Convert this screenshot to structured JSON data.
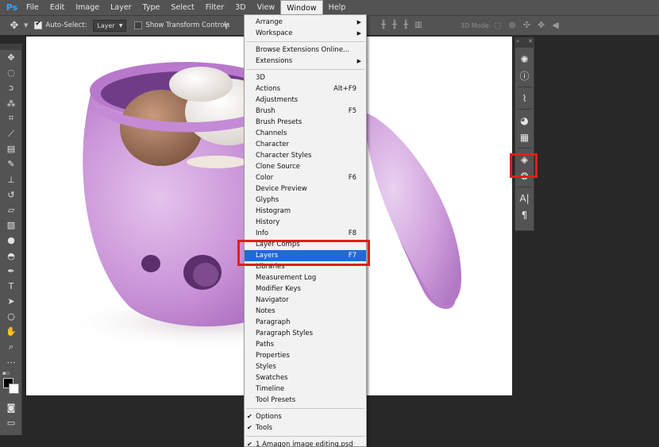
{
  "app": {
    "logo": "Ps"
  },
  "menubar": {
    "items": [
      "File",
      "Edit",
      "Image",
      "Layer",
      "Type",
      "Select",
      "Filter",
      "3D",
      "View",
      "Window",
      "Help"
    ],
    "active": "Window"
  },
  "options": {
    "auto_select_label": "Auto-Select:",
    "auto_select_value": "Layer",
    "transform_label": "Show Transform Controls",
    "mode3d_label": "3D Mode:"
  },
  "window_menu": {
    "group1": [
      {
        "label": "Arrange",
        "submenu": true
      },
      {
        "label": "Workspace",
        "submenu": true
      }
    ],
    "group2": [
      {
        "label": "Browse Extensions Online...",
        "submenu": false
      },
      {
        "label": "Extensions",
        "submenu": true
      }
    ],
    "group3": [
      {
        "label": "3D",
        "shortcut": ""
      },
      {
        "label": "Actions",
        "shortcut": "Alt+F9"
      },
      {
        "label": "Adjustments",
        "shortcut": ""
      },
      {
        "label": "Brush",
        "shortcut": "F5"
      },
      {
        "label": "Brush Presets",
        "shortcut": ""
      },
      {
        "label": "Channels",
        "shortcut": ""
      },
      {
        "label": "Character",
        "shortcut": ""
      },
      {
        "label": "Character Styles",
        "shortcut": ""
      },
      {
        "label": "Clone Source",
        "shortcut": ""
      },
      {
        "label": "Color",
        "shortcut": "F6"
      },
      {
        "label": "Device Preview",
        "shortcut": ""
      },
      {
        "label": "Glyphs",
        "shortcut": ""
      },
      {
        "label": "Histogram",
        "shortcut": ""
      },
      {
        "label": "History",
        "shortcut": ""
      },
      {
        "label": "Info",
        "shortcut": "F8"
      },
      {
        "label": "Layer Comps",
        "shortcut": ""
      },
      {
        "label": "Layers",
        "shortcut": "F7",
        "highlighted": true
      },
      {
        "label": "Libraries",
        "shortcut": ""
      },
      {
        "label": "Measurement Log",
        "shortcut": ""
      },
      {
        "label": "Modifier Keys",
        "shortcut": ""
      },
      {
        "label": "Navigator",
        "shortcut": ""
      },
      {
        "label": "Notes",
        "shortcut": ""
      },
      {
        "label": "Paragraph",
        "shortcut": ""
      },
      {
        "label": "Paragraph Styles",
        "shortcut": ""
      },
      {
        "label": "Paths",
        "shortcut": ""
      },
      {
        "label": "Properties",
        "shortcut": ""
      },
      {
        "label": "Styles",
        "shortcut": ""
      },
      {
        "label": "Swatches",
        "shortcut": ""
      },
      {
        "label": "Timeline",
        "shortcut": ""
      },
      {
        "label": "Tool Presets",
        "shortcut": ""
      }
    ],
    "group4": [
      {
        "label": "Options",
        "checked": true
      },
      {
        "label": "Tools",
        "checked": true
      }
    ],
    "group5": [
      {
        "label": "1 Amagon image editing.psd",
        "checked": true
      }
    ]
  },
  "toolbar_icons": [
    "move-icon",
    "marquee-icon",
    "lasso-icon",
    "magic-wand-icon",
    "crop-icon",
    "eyedropper-icon",
    "healing-icon",
    "brush-icon",
    "clone-stamp-icon",
    "history-brush-icon",
    "eraser-icon",
    "gradient-icon",
    "blur-icon",
    "dodge-icon",
    "pen-icon",
    "type-icon",
    "path-select-icon",
    "ellipse-icon",
    "hand-icon",
    "zoom-icon",
    "more-icon"
  ],
  "right_dock_icons": [
    "adjust-sun-icon",
    "info-icon",
    "paths-icon",
    "color-palette-icon",
    "grid-icon",
    "layers-icon",
    "channels-icon",
    "character-icon",
    "paragraph-icon"
  ],
  "colors": {
    "accent": "#1e6bd6",
    "highlight_box": "#e01e1e",
    "pot": "#c98fd6"
  }
}
